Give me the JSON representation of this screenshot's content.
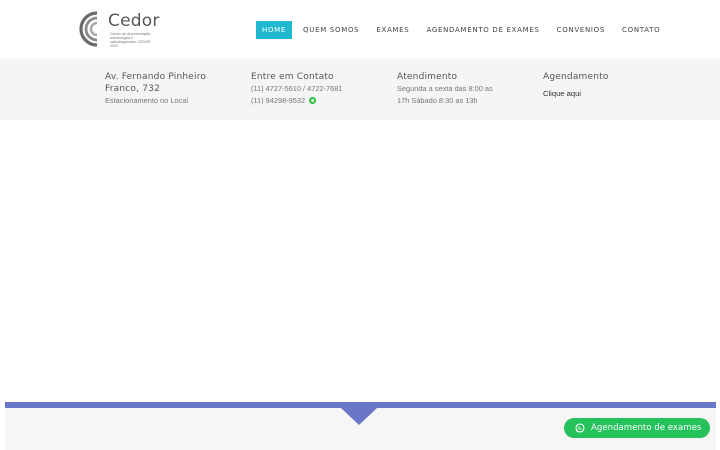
{
  "logo": {
    "name": "Cedor",
    "subtitle": "Centro de documentação odontológica e radiodiagnóstico CEDOR 2022"
  },
  "nav": {
    "items": [
      {
        "label": "HOME",
        "active": true
      },
      {
        "label": "QUEM SOMOS",
        "active": false
      },
      {
        "label": "EXAMES",
        "active": false
      },
      {
        "label": "AGENDAMENTO DE EXAMES",
        "active": false
      },
      {
        "label": "CONVENIOS",
        "active": false
      },
      {
        "label": "CONTATO",
        "active": false
      }
    ]
  },
  "info": {
    "address": {
      "title_line1": "Av. Fernando Pinheiro",
      "title_line2": "Franco, 732",
      "note": "Estacionamento no Local"
    },
    "contact": {
      "title": "Entre em Contato",
      "phone": "(11) 4727-5610 / 4722-7681",
      "whatsapp": "(11) 94298-9532",
      "whatsapp_icon": "whatsapp-icon"
    },
    "hours": {
      "title": "Atendimento",
      "line1": "Segunda a sexta das 8:00 as",
      "line2": "17h Sábado 8:30 as 13h"
    },
    "schedule": {
      "title": "Agendamento",
      "link": "Clique aqui"
    }
  },
  "floating_button": {
    "label": "Agendamento de exames",
    "icon": "whatsapp-icon"
  },
  "colors": {
    "accent": "#1fb8cf",
    "whatsapp": "#25c15b",
    "strip": "#6a76c8",
    "infobar_bg": "#f5f5f5"
  }
}
